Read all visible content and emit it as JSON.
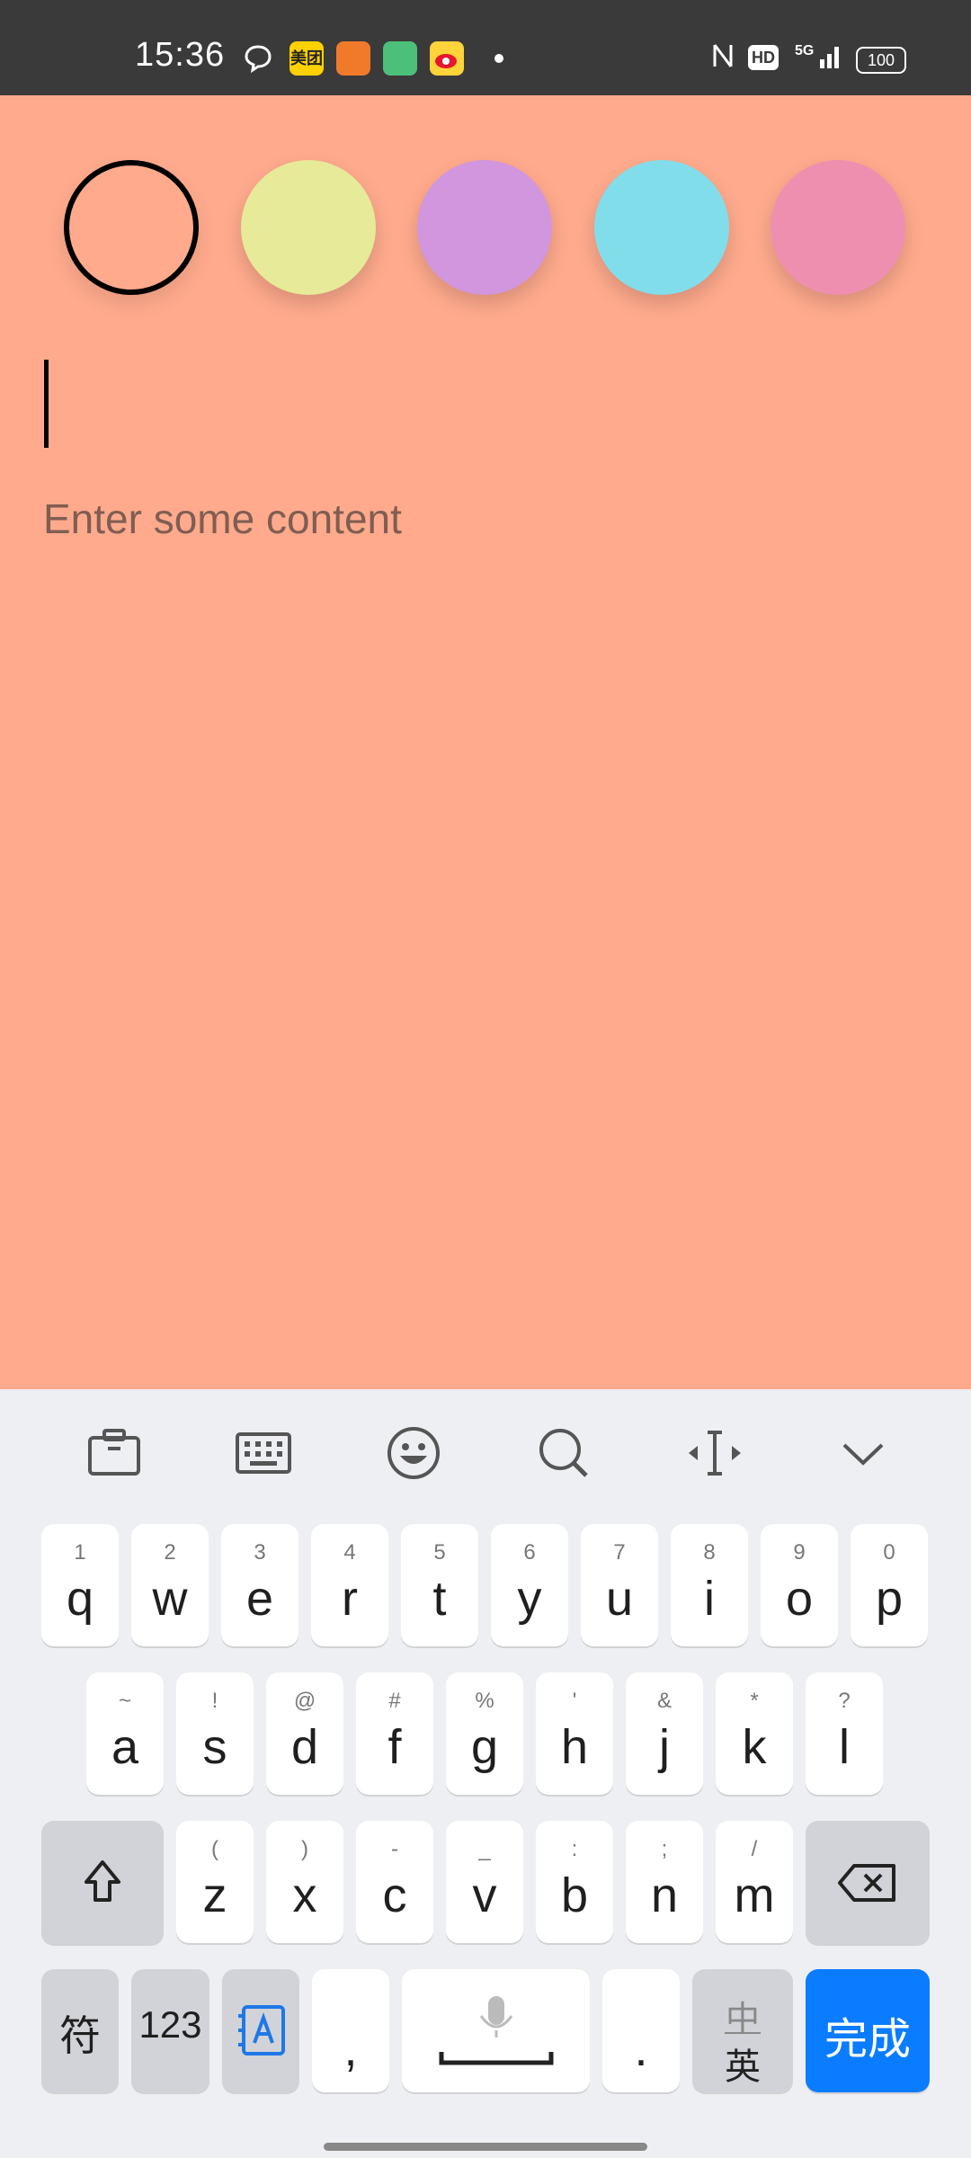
{
  "status_bar": {
    "time": "15:36",
    "app_badge_1": "美团",
    "network": "5G",
    "hd": "HD",
    "battery": "100"
  },
  "colors": {
    "background": "#FFAA8D",
    "swatches": [
      "#FFAA8D",
      "#E7EA98",
      "#D196DD",
      "#82DDEB",
      "#EF8FB0"
    ],
    "selected_index": 0
  },
  "editor": {
    "title_value": "",
    "content_placeholder": "Enter some content"
  },
  "keyboard": {
    "toolbar": [
      "toolbox-icon",
      "keyboard-icon",
      "emoji-icon",
      "search-icon",
      "cursor-move-icon",
      "collapse-icon"
    ],
    "row1": [
      {
        "sup": "1",
        "key": "q"
      },
      {
        "sup": "2",
        "key": "w"
      },
      {
        "sup": "3",
        "key": "e"
      },
      {
        "sup": "4",
        "key": "r"
      },
      {
        "sup": "5",
        "key": "t"
      },
      {
        "sup": "6",
        "key": "y"
      },
      {
        "sup": "7",
        "key": "u"
      },
      {
        "sup": "8",
        "key": "i"
      },
      {
        "sup": "9",
        "key": "o"
      },
      {
        "sup": "0",
        "key": "p"
      }
    ],
    "row2": [
      {
        "sup": "~",
        "key": "a"
      },
      {
        "sup": "!",
        "key": "s"
      },
      {
        "sup": "@",
        "key": "d"
      },
      {
        "sup": "#",
        "key": "f"
      },
      {
        "sup": "%",
        "key": "g"
      },
      {
        "sup": "'",
        "key": "h"
      },
      {
        "sup": "&",
        "key": "j"
      },
      {
        "sup": "*",
        "key": "k"
      },
      {
        "sup": "?",
        "key": "l"
      }
    ],
    "row3": [
      {
        "sup": "(",
        "key": "z"
      },
      {
        "sup": ")",
        "key": "x"
      },
      {
        "sup": "-",
        "key": "c"
      },
      {
        "sup": "_",
        "key": "v"
      },
      {
        "sup": ":",
        "key": "b"
      },
      {
        "sup": ";",
        "key": "n"
      },
      {
        "sup": "/",
        "key": "m"
      }
    ],
    "symbols_label": "符",
    "numbers_label": "123",
    "comma": ",",
    "period": ".",
    "lang_top": "中",
    "lang_bottom": "英",
    "done_label": "完成"
  }
}
